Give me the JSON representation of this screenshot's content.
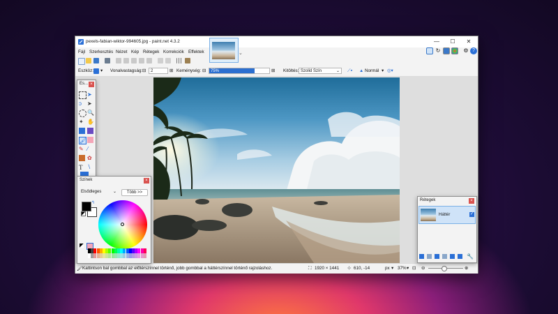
{
  "window": {
    "title": "pexels-fabian-wiktor-994605.jpg - paint.net 4.3.2",
    "minimize_glyph": "—",
    "maximize_glyph": "☐",
    "close_glyph": "✕"
  },
  "menu": [
    "Fájl",
    "Szerkesztés",
    "Nézet",
    "Kép",
    "Rétegek",
    "Korrekciók",
    "Effektek"
  ],
  "toolbar": {
    "tool_label": "Eszköz:",
    "brush_width_label": "Vonalvastagság:",
    "brush_width_value": "2",
    "hardness_label": "Keménység:",
    "hardness_value": "75%",
    "hardness_fraction": 0.75,
    "fill_label": "Kitöltés:",
    "fill_value": "Szolid Szín",
    "blend_value": "Normál"
  },
  "tools_panel": {
    "title": "Es..."
  },
  "colors_panel": {
    "title": "Színek",
    "mode_value": "Elsődleges",
    "more_button": "Több >>",
    "primary_color": "#000000",
    "secondary_color": "#ffffff"
  },
  "layers_panel": {
    "title": "Rétegek",
    "layers": [
      {
        "name": "Háttér",
        "visible": true
      }
    ]
  },
  "status": {
    "hint": "Kattintson bal gombbal az előtérszínnel történő, jobb gombbal a háttérszínnel történő rajzoláshoz.",
    "image_size": "1920 × 1441",
    "cursor_pos": "610, -14",
    "unit": "px",
    "zoom": "37%"
  },
  "icons": [
    "paintnet-icon",
    "new-icon",
    "open-icon",
    "save-icon",
    "print-icon",
    "cut-icon",
    "copy-icon",
    "paste-icon",
    "crop-icon",
    "deselect-icon",
    "undo-icon",
    "redo-icon",
    "grid-icon",
    "ruler-icon",
    "settings-icon",
    "help-icon"
  ]
}
